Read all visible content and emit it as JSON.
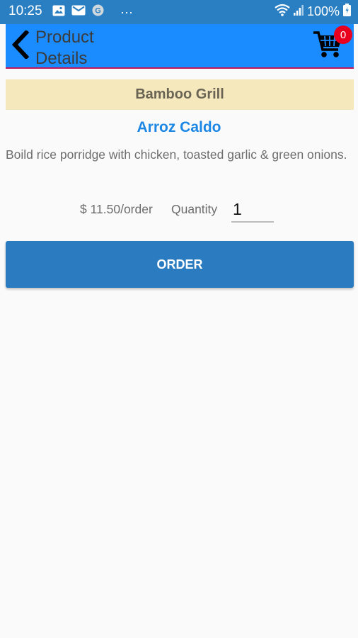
{
  "status_bar": {
    "time": "10:25",
    "more": "···",
    "battery": "100%",
    "icons": [
      "image-icon",
      "mail-icon",
      "g-icon",
      "wifi-icon",
      "signal-icon",
      "battery-icon"
    ]
  },
  "app_bar": {
    "title": "Product Details",
    "cart_count": "0",
    "color": "#1a8cff"
  },
  "store": {
    "name": "Bamboo Grill"
  },
  "product": {
    "name": "Arroz Caldo",
    "description": "Boild rice porridge with chicken, toasted garlic & green onions.",
    "price": "$ 11.50/order",
    "quantity_label": "Quantity",
    "quantity_value": "1"
  },
  "actions": {
    "order_label": "ORDER"
  },
  "colors": {
    "status_bar": "#2a7fc3",
    "banner": "#f6e8bd",
    "product_name": "#1c87e5",
    "order_button": "#2a7bbf",
    "badge": "#e8001c"
  }
}
